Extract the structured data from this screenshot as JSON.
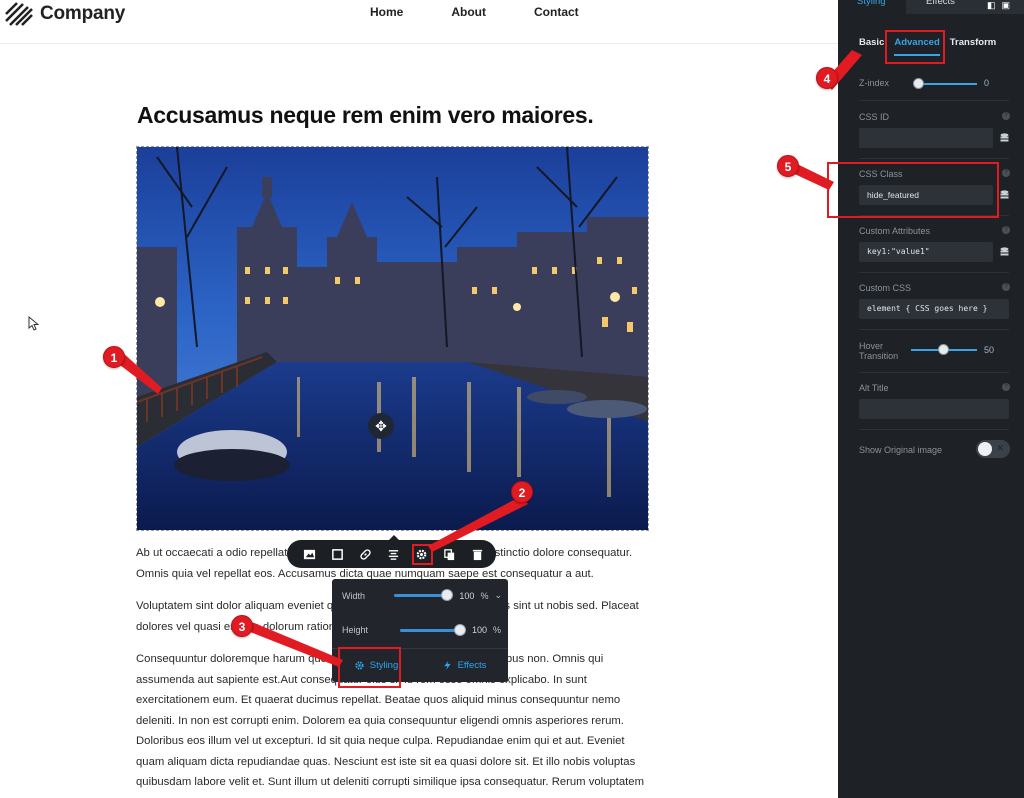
{
  "header": {
    "logo_text": "Company",
    "nav": [
      {
        "label": "Home"
      },
      {
        "label": "About"
      },
      {
        "label": "Contact"
      }
    ]
  },
  "article": {
    "title": "Accusamus neque rem enim vero maiores.",
    "paragraphs": [
      "Ab ut occaecati a odio repellat quasi iure consequatur vel eos. Sed et distinctio dolore consequatur. Omnis quia vel repellat eos. Accusamus dicta quae numquam saepe est consequatur a aut.",
      "Voluptatem sint dolor aliquam eveniet qui. Eaque dolor et officia asperiores sint ut nobis sed. Placeat dolores vel quasi est iste dolorum ratione voluptas et accusamus.",
      "Consequuntur doloremque harum quo. Aut sunt quas harum dolor temporibus non. Omnis qui assumenda aut sapiente est.Aut consequatur eius sit id rem esse omnis explicabo. In sunt exercitationem eum. Et quaerat ducimus repellat. Beatae quos aliquid minus consequuntur nemo deleniti. In non est corrupti enim. Dolorem ea quia consequuntur eligendi omnis asperiores rerum. Doloribus eos illum vel ut excepturi. Id sit quia neque culpa. Repudiandae enim qui et aut. Eveniet quam aliquam dicta repudiandae quas. Nesciunt est iste sit ea quasi dolore sit. Et illo nobis voluptas quibusdam labore velit et. Sunt illum ut deleniti corrupti similique ipsa consequatur. Rerum voluptatem incidunt"
    ]
  },
  "image_toolbar": {
    "buttons": [
      "image-icon",
      "frame-icon",
      "link-icon",
      "align-icon",
      "gear-icon",
      "duplicate-icon",
      "trash-icon"
    ]
  },
  "size_popover": {
    "width_label": "Width",
    "width_value": "100",
    "width_unit": "%",
    "width_fraction": 1.0,
    "height_label": "Height",
    "height_value": "100",
    "height_unit": "%",
    "height_fraction": 1.0,
    "tab_styling": "Styling",
    "tab_effects": "Effects"
  },
  "panel": {
    "tab_styling": "Styling",
    "tab_effects": "Effects",
    "subtabs": {
      "basic": "Basic",
      "advanced": "Advanced",
      "transform": "Transform"
    },
    "zindex_label": "Z-index",
    "zindex_value": "0",
    "css_id_label": "CSS ID",
    "css_id_value": "",
    "css_class_label": "CSS Class",
    "css_class_value": "hide_featured",
    "custom_attr_label": "Custom Attributes",
    "custom_attr_value": "key1:\"value1\"",
    "custom_css_label": "Custom CSS",
    "custom_css_value": "element { CSS goes here }",
    "hover_label_1": "Hover",
    "hover_label_2": "Transition",
    "hover_value": "50",
    "alt_title_label": "Alt Title",
    "alt_title_value": "",
    "show_original_label": "Show Original image"
  },
  "annotations": [
    {
      "number": "1"
    },
    {
      "number": "2"
    },
    {
      "number": "3"
    },
    {
      "number": "4"
    },
    {
      "number": "5"
    }
  ],
  "colors": {
    "accent": "#3aa2e6",
    "annotation_red": "#e11b22",
    "panel_bg": "#1e2227"
  }
}
